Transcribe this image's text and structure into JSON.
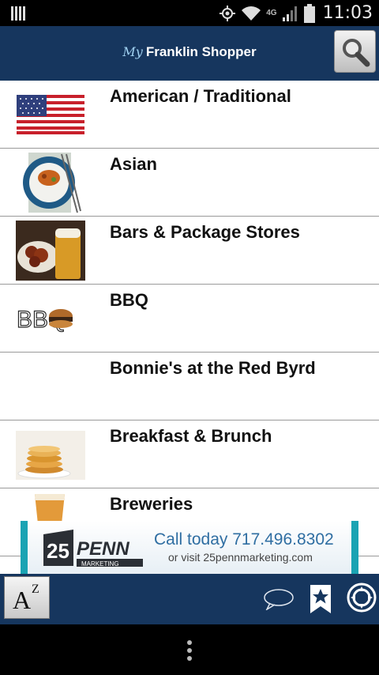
{
  "status_bar": {
    "time": "11:03",
    "network": "4G",
    "icons": [
      "notification-icon",
      "location-icon",
      "wifi-icon",
      "signal-icon",
      "battery-icon"
    ]
  },
  "header": {
    "logo_prefix": "My",
    "logo_text": "Franklin Shopper",
    "search_icon": "magnifier-icon"
  },
  "categories": [
    {
      "label": "American / Traditional",
      "thumb": "us-flag"
    },
    {
      "label": "Asian",
      "thumb": "rice-bowl"
    },
    {
      "label": "Bars & Package Stores",
      "thumb": "wings-and-beer"
    },
    {
      "label": "BBQ",
      "thumb": "bbq-logo"
    },
    {
      "label": "Bonnie's at the Red Byrd",
      "thumb": ""
    },
    {
      "label": "Breakfast & Brunch",
      "thumb": "pancakes"
    },
    {
      "label": "Breweries",
      "thumb": "beer-glass"
    }
  ],
  "bbq_thumb_letters": "BBQ",
  "ad": {
    "brand_number": "25",
    "brand_name": "PENN",
    "brand_sub": "MARKETING",
    "line1": "Call today 717.496.8302",
    "line2": "or visit 25pennmarketing.com",
    "accent_color": "#1aa3b3"
  },
  "toolbar": {
    "az_main": "A",
    "az_sup": "Z",
    "icons": [
      "chat-bubble-icon",
      "bookmark-star-icon",
      "compass-icon"
    ]
  },
  "colors": {
    "header_bg": "#16365e",
    "list_bg": "#ffffff",
    "divider": "#9a9a9a"
  }
}
